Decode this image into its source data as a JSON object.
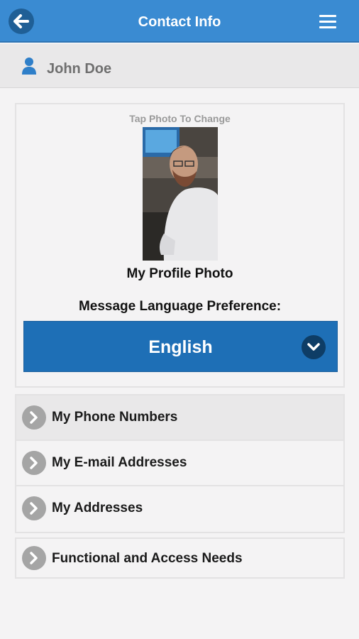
{
  "header": {
    "title": "Contact Info",
    "back_icon": "arrow-left-icon",
    "menu_icon": "hamburger-menu-icon",
    "bar_color": "#3a8bd2"
  },
  "user": {
    "name": "John Doe",
    "icon": "person-icon",
    "icon_color": "#2f7fc9"
  },
  "profile": {
    "tap_hint": "Tap Photo To Change",
    "photo_label": "My Profile Photo"
  },
  "language": {
    "label": "Message Language Preference:",
    "selected": "English",
    "select_color": "#1e6fb6"
  },
  "sections": [
    {
      "label": "My Phone Numbers",
      "icon": "chevron-right-icon"
    },
    {
      "label": "My E-mail Addresses",
      "icon": "chevron-right-icon"
    },
    {
      "label": "My Addresses",
      "icon": "chevron-right-icon"
    }
  ],
  "needs": {
    "label": "Functional and Access Needs",
    "icon": "chevron-right-icon"
  }
}
